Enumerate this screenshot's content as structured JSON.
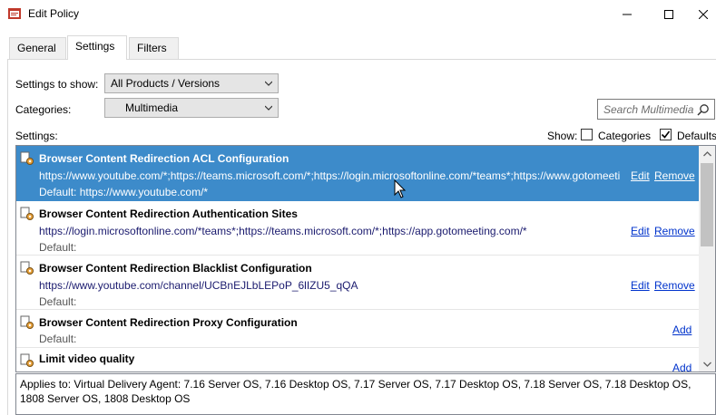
{
  "window": {
    "title": "Edit Policy"
  },
  "tabs": [
    {
      "label": "General"
    },
    {
      "label": "Settings"
    },
    {
      "label": "Filters"
    }
  ],
  "filters": {
    "settings_to_show_label": "Settings to show:",
    "settings_to_show_value": "All Products / Versions",
    "categories_label": "Categories:",
    "categories_value": "Multimedia",
    "search_placeholder": "Search Multimedia",
    "settings_label": "Settings:",
    "show_label": "Show:",
    "show_categories_label": "Categories",
    "show_categories_checked": false,
    "show_defaults_label": "Defaults",
    "show_defaults_checked": true
  },
  "settings": [
    {
      "title": "Browser Content Redirection ACL Configuration",
      "value": "https://www.youtube.com/*;https://teams.microsoft.com/*;https://login.microsoftonline.com/*teams*;https://www.gotomeeting.com/*",
      "default": "Default: https://www.youtube.com/*",
      "actions": [
        "Edit",
        "Remove"
      ]
    },
    {
      "title": "Browser Content Redirection Authentication Sites",
      "value": "https://login.microsoftonline.com/*teams*;https://teams.microsoft.com/*;https://app.gotomeeting.com/*",
      "default": "Default:",
      "actions": [
        "Edit",
        "Remove"
      ]
    },
    {
      "title": "Browser Content Redirection Blacklist Configuration",
      "value": "https://www.youtube.com/channel/UCBnEJLbLEPoP_6lIZU5_qQA",
      "default": "Default:",
      "actions": [
        "Edit",
        "Remove"
      ]
    },
    {
      "title": "Browser Content Redirection Proxy Configuration",
      "value": "",
      "default": "Default:",
      "actions": [
        "Add"
      ]
    },
    {
      "title": "Limit video quality",
      "value": "",
      "default": "",
      "actions": [
        "Add"
      ]
    }
  ],
  "applies_to": "Applies to: Virtual Delivery Agent: 7.16 Server OS, 7.16 Desktop OS, 7.17 Server OS, 7.17 Desktop OS, 7.18 Server OS, 7.18 Desktop OS, 1808 Server OS, 1808 Desktop OS",
  "colors": {
    "selection": "#3d8bca",
    "link": "#0033cc"
  }
}
